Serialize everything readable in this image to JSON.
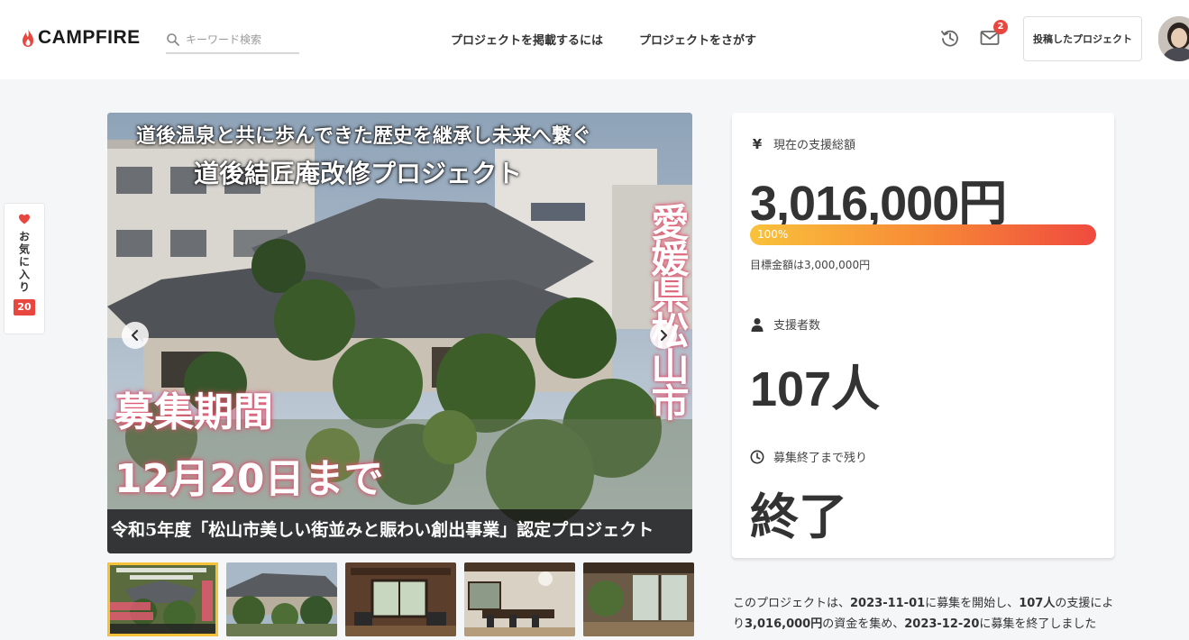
{
  "header": {
    "logo_text": "CAMPFIRE",
    "search_placeholder": "キーワード検索",
    "nav": [
      "プロジェクトを掲載するには",
      "プロジェクトをさがす"
    ],
    "mail_badge": "2",
    "posted_button": "投稿したプロジェクト"
  },
  "favorite": {
    "label": "お気に入り",
    "count": "20"
  },
  "hero": {
    "line1": "道後温泉と共に歩んできた歴史を継承し未来へ繋ぐ",
    "line2": "道後結匠庵改修プロジェクト",
    "vertical": "愛媛県松山市",
    "period": "募集期間",
    "deadline": "12月20日まで",
    "bottom": "令和5年度「松山市美しい街並みと賑わい創出事業」認定プロジェクト"
  },
  "stats": {
    "amount_label": "現在の支援総額",
    "amount_value": "3,016,000円",
    "progress_label": "100%",
    "progress_fraction": 1.0,
    "goal_text": "目標金額は3,000,000円",
    "backers_label": "支援者数",
    "backers_value": "107人",
    "remain_label": "募集終了まで残り",
    "remain_value": "終了",
    "yen_symbol": "¥"
  },
  "summary": {
    "t1": "このプロジェクトは、",
    "start": "2023-11-01",
    "t2": "に募集を開始し、",
    "backers": "107人",
    "t3": "の支援により",
    "amount": "3,016,000円",
    "t4": "の資金を集め、",
    "end": "2023-12-20",
    "t5": "に募集を終了しました"
  },
  "colors": {
    "accent": "#e8473f",
    "progress_start": "#f9c23b",
    "progress_end": "#ef4a3f",
    "thumb_active": "#f5c23a"
  }
}
